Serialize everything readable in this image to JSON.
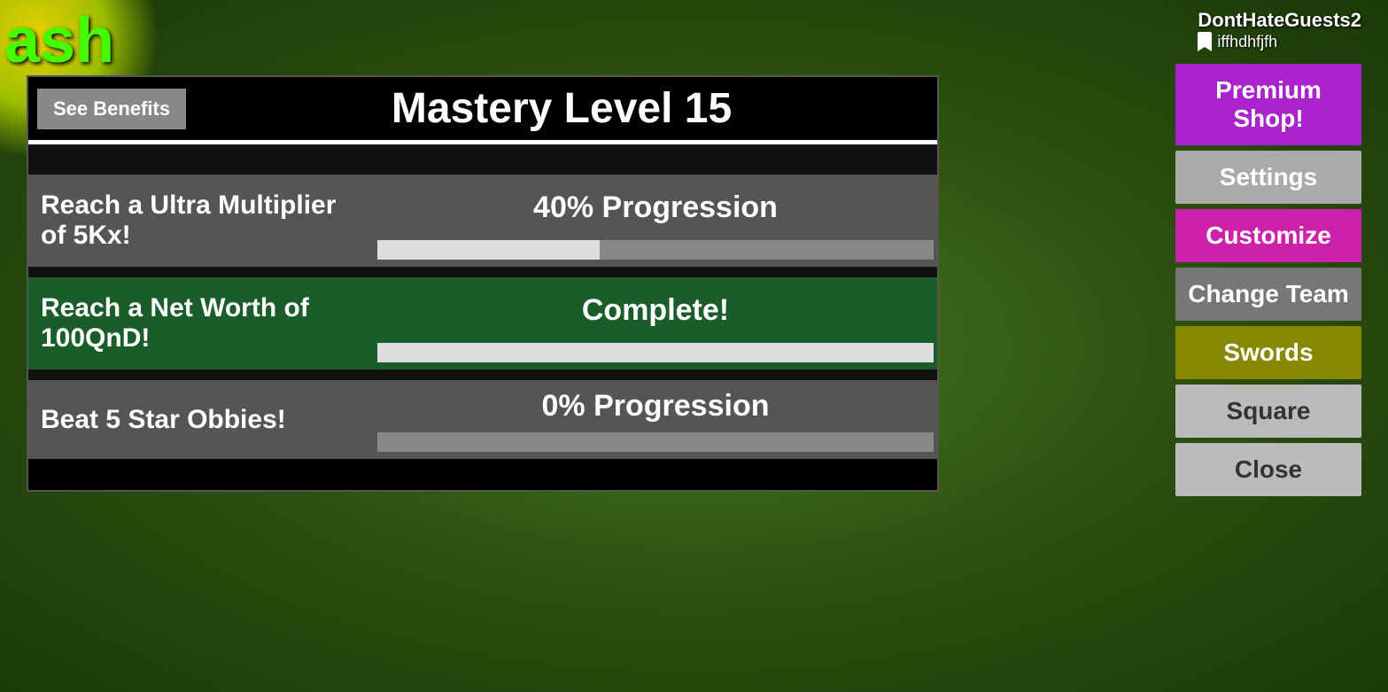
{
  "background": {
    "splash_color": "#ffe000"
  },
  "top_left": {
    "text": "ash"
  },
  "panel": {
    "see_benefits_label": "See Benefits",
    "mastery_title": "Mastery Level 15",
    "tasks": [
      {
        "id": "ultra-multiplier",
        "label": "Reach a Ultra Multiplier of 5Kx!",
        "status": "40% Progression",
        "progress_pct": 40,
        "complete": false
      },
      {
        "id": "net-worth",
        "label": "Reach a Net Worth of 100QnD!",
        "status": "Complete!",
        "progress_pct": 100,
        "complete": true
      },
      {
        "id": "star-obbies",
        "label": "Beat 5 Star Obbies!",
        "status": "0% Progression",
        "progress_pct": 0,
        "complete": false
      }
    ]
  },
  "right_panel": {
    "username": "DontHateGuests2",
    "username_sub": "iffhdhfjfh",
    "buttons": [
      {
        "id": "premium-shop",
        "label": "Premium Shop!",
        "style": "purple"
      },
      {
        "id": "settings",
        "label": "Settings",
        "style": "gray"
      },
      {
        "id": "customize",
        "label": "Customize",
        "style": "magenta"
      },
      {
        "id": "change-team",
        "label": "Change Team",
        "style": "dark-gray"
      },
      {
        "id": "swords",
        "label": "Swords",
        "style": "olive"
      },
      {
        "id": "square",
        "label": "Square",
        "style": "light-gray"
      },
      {
        "id": "close",
        "label": "Close",
        "style": "light-gray"
      }
    ]
  }
}
